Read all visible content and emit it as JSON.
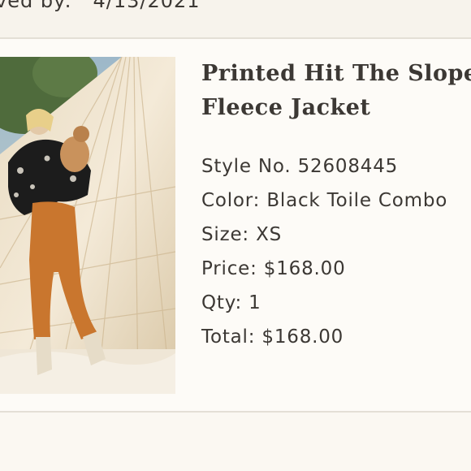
{
  "header": {
    "partial_text": "ved by:   4/13/2021"
  },
  "product": {
    "title_line1": "Printed Hit The Slopes",
    "title_line2": "Fleece Jacket",
    "style_label": "Style No.",
    "style_value": "52608445",
    "color_label": "Color:",
    "color_value": "Black Toile Combo",
    "size_label": "Size:",
    "size_value": "XS",
    "price_label": "Price:",
    "price_value": "$168.00",
    "qty_label": "Qty:",
    "qty_value": "1",
    "total_label": "Total:",
    "total_value": "$168.00"
  },
  "colors": {
    "background": "#fbf8f2",
    "text": "#3c3834",
    "divider": "#e4dfd6"
  }
}
